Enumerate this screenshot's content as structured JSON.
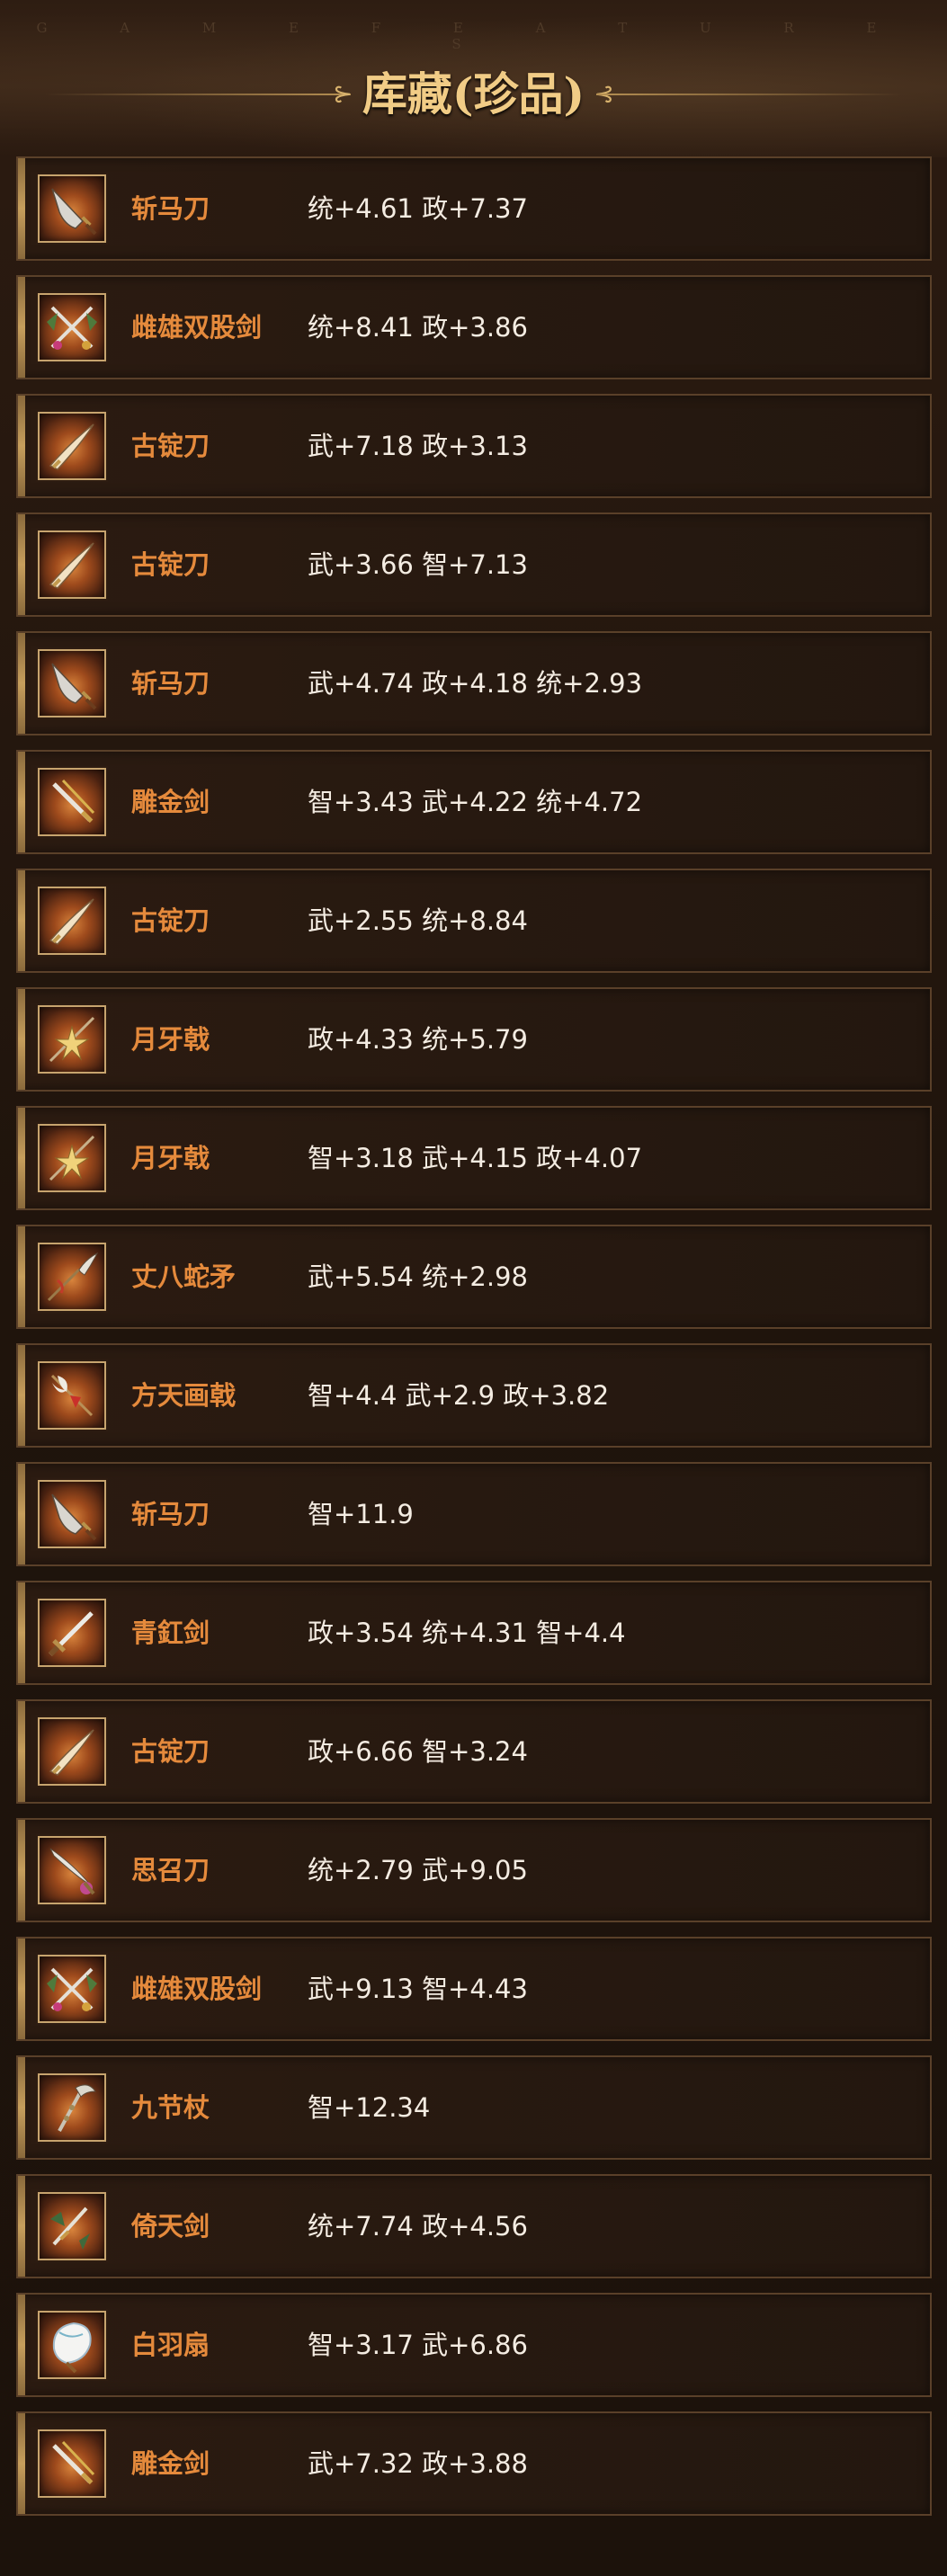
{
  "header": {
    "subtitle": "G A M E   F E A T U R E S",
    "title": "库藏(珍品)",
    "ornament_left": "⊱",
    "ornament_right": "⊰"
  },
  "items": [
    {
      "name": "斩马刀",
      "stats": "统+4.61 政+7.37",
      "icon": "broad-blade-icon"
    },
    {
      "name": "雌雄双股剑",
      "stats": "统+8.41 政+3.86",
      "icon": "twin-swords-icon"
    },
    {
      "name": "古锭刀",
      "stats": "武+7.18 政+3.13",
      "icon": "sabre-icon"
    },
    {
      "name": "古锭刀",
      "stats": "武+3.66 智+7.13",
      "icon": "sabre-icon"
    },
    {
      "name": "斩马刀",
      "stats": "武+4.74 政+4.18 统+2.93",
      "icon": "broad-blade-icon"
    },
    {
      "name": "雕金剑",
      "stats": "智+3.43 武+4.22 统+4.72",
      "icon": "golden-sword-icon"
    },
    {
      "name": "古锭刀",
      "stats": "武+2.55 统+8.84",
      "icon": "sabre-icon"
    },
    {
      "name": "月牙戟",
      "stats": "政+4.33 统+5.79",
      "icon": "crescent-halberd-icon"
    },
    {
      "name": "月牙戟",
      "stats": "智+3.18 武+4.15 政+4.07",
      "icon": "crescent-halberd-icon"
    },
    {
      "name": "丈八蛇矛",
      "stats": "武+5.54 统+2.98",
      "icon": "serpent-spear-icon"
    },
    {
      "name": "方天画戟",
      "stats": "智+4.4 武+2.9 政+3.82",
      "icon": "painted-halberd-icon"
    },
    {
      "name": "斩马刀",
      "stats": "智+11.9",
      "icon": "broad-blade-icon"
    },
    {
      "name": "青釭剑",
      "stats": "政+3.54 统+4.31 智+4.4",
      "icon": "straight-sword-icon"
    },
    {
      "name": "古锭刀",
      "stats": "政+6.66 智+3.24",
      "icon": "sabre-icon"
    },
    {
      "name": "思召刀",
      "stats": "统+2.79 武+9.05",
      "icon": "tasseled-sabre-icon"
    },
    {
      "name": "雌雄双股剑",
      "stats": "武+9.13 智+4.43",
      "icon": "twin-swords-icon"
    },
    {
      "name": "九节杖",
      "stats": "智+12.34",
      "icon": "staff-icon"
    },
    {
      "name": "倚天剑",
      "stats": "统+7.74 政+4.56",
      "icon": "heaven-sword-icon"
    },
    {
      "name": "白羽扇",
      "stats": "智+3.17 武+6.86",
      "icon": "feather-fan-icon"
    },
    {
      "name": "雕金剑",
      "stats": "武+7.32 政+3.88",
      "icon": "golden-sword-icon"
    }
  ]
}
